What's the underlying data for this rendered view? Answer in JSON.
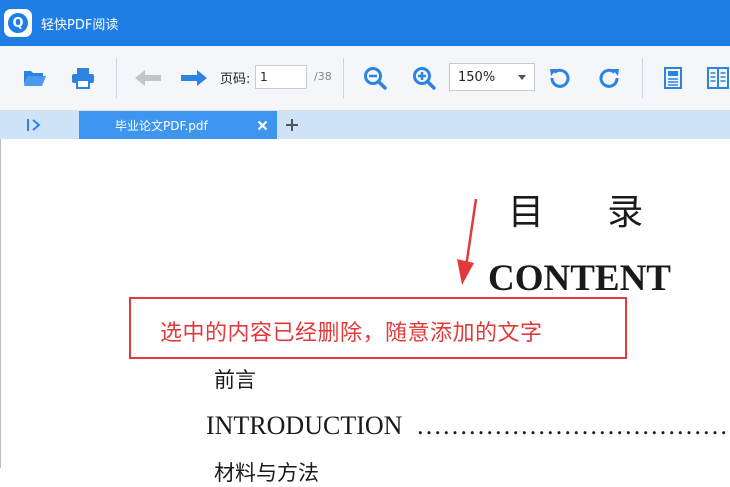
{
  "window": {
    "app_title": "轻快PDF阅读",
    "logo_letter": "Q"
  },
  "toolbar": {
    "page_label": "页码:",
    "current_page": "1",
    "total_pages": "/38",
    "zoom_value": "150%"
  },
  "tabs": [
    {
      "label": "毕业论文PDF.pdf",
      "close_symbol": "×"
    }
  ],
  "tab_add_symbol": "+",
  "document": {
    "heading": "目     录",
    "content_title": "CONTENT",
    "annotation_text": "选中的内容已经删除，随意添加的文字",
    "toc": {
      "foreword": "前言",
      "introduction": "INTRODUCTION",
      "dots": "…………………………………………",
      "partial_line": "材料与方法"
    }
  },
  "colors": {
    "titlebar": "#1e7ee6",
    "toolbar_icon": "#2c83e0",
    "tab_active": "#3d95f0",
    "tab_bar": "#cfe3f8",
    "annotation": "#e23a3a"
  },
  "icons": [
    "app-logo",
    "open-folder-icon",
    "print-icon",
    "arrow-left-icon",
    "arrow-right-icon",
    "zoom-out-icon",
    "zoom-in-icon",
    "rotate-left-icon",
    "rotate-right-icon",
    "single-page-icon",
    "double-page-icon",
    "sidebar-toggle-icon",
    "close-icon",
    "plus-icon"
  ]
}
